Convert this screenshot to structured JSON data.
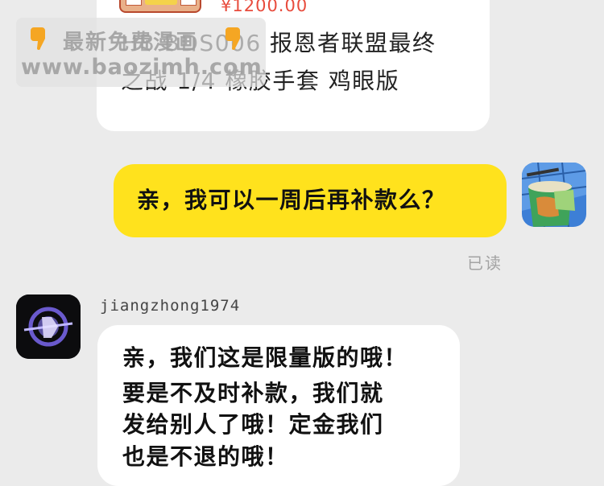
{
  "product_card": {
    "price": "¥1200.00",
    "title_line1": "HB BDS006 报恩者联盟最终",
    "title_line2": "之战 1/4 橡胶手套 鸡眼版"
  },
  "watermark": {
    "line1": "最新免费漫画",
    "line2": "www.baozimh.com"
  },
  "message_mine": {
    "text": "亲，我可以一周后再补款么？",
    "status": "已读"
  },
  "message_other": {
    "username": "jiangzhong1974",
    "line1": "亲，我们这是限量版的哦！",
    "line2": "要是不及时补款，我们就",
    "line3": "发给别人了哦！定金我们",
    "line4": "也是不退的哦！"
  },
  "colors": {
    "background": "#ebebeb",
    "bubble_mine": "#ffe21d",
    "bubble_other": "#ffffff",
    "price": "#e84c3d"
  },
  "icons": {
    "watermark_hand": "pointing-down-hand-icon",
    "avatar_mine": "instant-noodle-cup-avatar",
    "avatar_other": "dark-logo-avatar"
  }
}
